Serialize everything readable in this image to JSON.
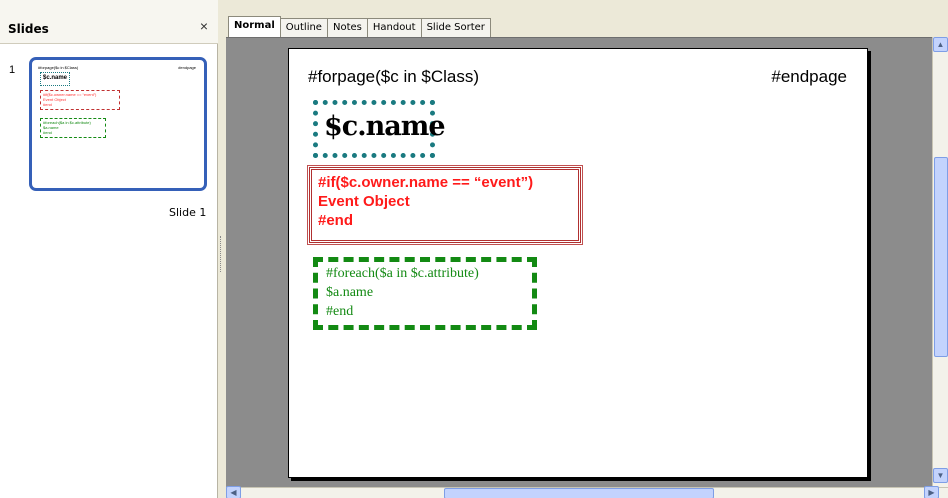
{
  "slides_pane": {
    "title": "Slides",
    "close_glyph": "×",
    "slide_number": "1",
    "slide_label": "Slide 1"
  },
  "tabs": [
    {
      "label": "Normal",
      "active": true
    },
    {
      "label": "Outline",
      "active": false
    },
    {
      "label": "Notes",
      "active": false
    },
    {
      "label": "Handout",
      "active": false
    },
    {
      "label": "Slide Sorter",
      "active": false
    }
  ],
  "slide": {
    "header_left": "#forpage($c in $Class)",
    "header_right": "#endpage",
    "box1_text": "$c.name",
    "box2_lines": [
      "#if($c.owner.name == “event”)",
      "Event Object",
      "#end"
    ],
    "box3_lines": [
      "#foreach($a in $c.attribute)",
      "$a.name",
      "#end"
    ]
  },
  "icons": {
    "close": "close-icon",
    "scroll_up": "arrow-up-icon",
    "scroll_down": "arrow-down-icon",
    "scroll_left": "arrow-left-icon",
    "scroll_right": "arrow-right-icon"
  },
  "colors": {
    "teal_border": "#1a7a80",
    "red_text": "#ff1a1a",
    "green_text": "#138a13",
    "thumb_border": "#3560b8",
    "workspace_bg": "#8c8c8c"
  }
}
